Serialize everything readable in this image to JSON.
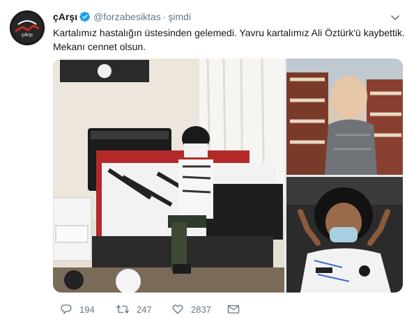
{
  "tweet": {
    "author_name": "çArşı",
    "author_handle": "@forzabesiktas",
    "separator": "·",
    "timestamp": "şimdi",
    "text": "Kartalımız hastalığın üstesinden gelemedi. Yavru kartalımız Ali Öztürk'ü kaybettik. Mekanı cennet olsun.",
    "verified": true,
    "avatar_text": "çArşı"
  },
  "actions": {
    "reply_count": "194",
    "retweet_count": "247",
    "like_count": "2837"
  },
  "media": {
    "photos": [
      {
        "label": "main-bedroom-photo"
      },
      {
        "label": "top-right-photo"
      },
      {
        "label": "bottom-right-photo"
      }
    ],
    "jersey_text": "BEŞİKTAŞ"
  },
  "colors": {
    "text": "#14171a",
    "secondary": "#657786",
    "verified": "#1da1f2",
    "border": "#e6ecf0"
  },
  "icons": [
    "verified-badge-icon",
    "chevron-down-icon",
    "reply-icon",
    "retweet-icon",
    "like-icon",
    "direct-message-icon"
  ]
}
